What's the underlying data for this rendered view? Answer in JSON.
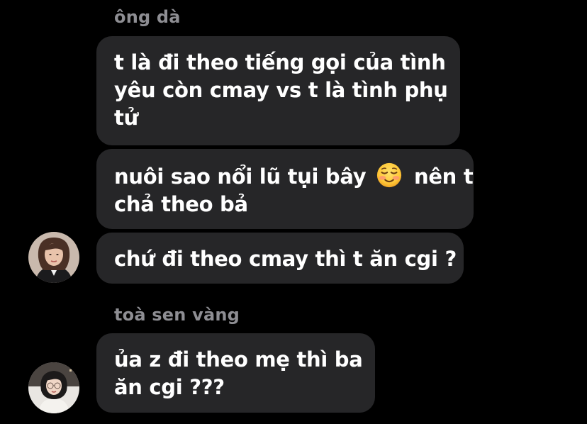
{
  "groups": [
    {
      "sender": "ông dà",
      "messages": [
        {
          "lines": [
            "t là đi theo tiếng gọi của tình",
            "yêu còn cmay vs t là tình phụ",
            "tử"
          ]
        },
        {
          "lines_before_emoji": "nuôi sao nổi lũ tụi bây",
          "emoji": "smiling-face-with-blush",
          "lines_after_emoji": "nên t",
          "line2": "chả theo bả"
        },
        {
          "lines": [
            "chứ đi theo cmay thì t ăn cgi ?"
          ]
        }
      ]
    },
    {
      "sender": "toà sen vàng",
      "messages": [
        {
          "lines": [
            "ủa z đi theo mẹ thì ba",
            "ăn cgi ???"
          ]
        }
      ]
    }
  ],
  "colors": {
    "background": "#000000",
    "bubble": "#262628",
    "sender_name": "#8e8e93",
    "text": "#ffffff"
  }
}
